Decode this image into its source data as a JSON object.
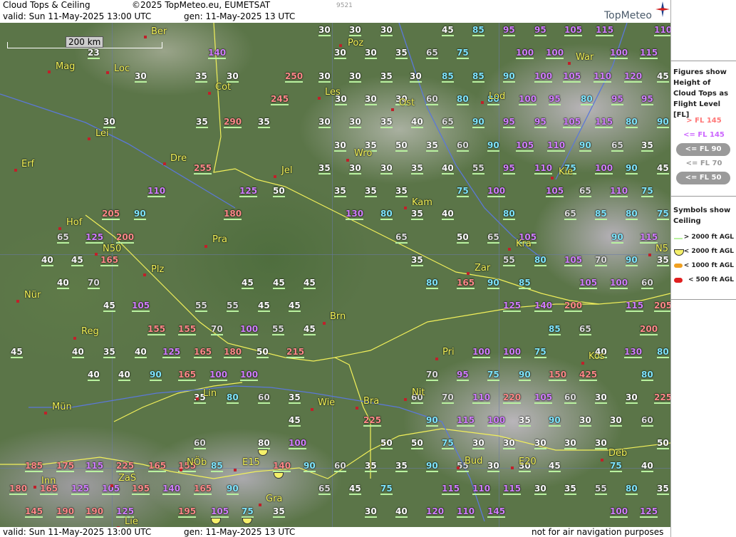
{
  "header": {
    "title": "Cloud Tops & Ceiling",
    "copyright": "©2025 TopMeteo.eu, EUMETSAT",
    "code": "9521",
    "valid": "valid:  Sun  11-May-2025  13:00 UTC",
    "gen": "gen: 11-May-2025 13 UTC",
    "brand": "TopMeteo"
  },
  "footer": {
    "valid": "valid:  Sun  11-May-2025  13:00 UTC",
    "gen": "gen: 11-May-2025 13 UTC",
    "disclaimer": "not for air navigation purposes"
  },
  "scale_label": "200 km",
  "legend": {
    "heading": "Figures show Height of Cloud Tops as Flight Level  [FL]",
    "items": [
      {
        "label": "> FL 145",
        "color": "#ff7777"
      },
      {
        "label": "<= FL 145",
        "color": "#cc66ff"
      },
      {
        "label": "<= FL 90",
        "color": "#55ddff"
      },
      {
        "label": "<= FL 70",
        "color": "#999999"
      },
      {
        "label": "<= FL 50",
        "color": "#ffffff"
      }
    ],
    "symbols_heading": "Symbols show Ceiling",
    "symbols": [
      {
        "label": "> 2000 ft AGL",
        "color": "#b9f2a0"
      },
      {
        "label": "< 2000 ft AGL",
        "color": "#f5f06a"
      },
      {
        "label": "< 1000 ft AGL",
        "color": "#f0a020"
      },
      {
        "label": "< 500 ft AGL",
        "color": "#e02020"
      }
    ]
  },
  "cities": [
    "Ber",
    "Poz",
    "War",
    "Mag",
    "Loc",
    "Cot",
    "Les",
    "Lod",
    "Ost",
    "Erf",
    "Lei",
    "Dre",
    "Jel",
    "Wro",
    "Kie",
    "Kam",
    "Hof",
    "Pra",
    "Kra",
    "N50",
    "Zar",
    "Plz",
    "Nür",
    "Brn",
    "Reg",
    "Pri",
    "Kos",
    "Lin",
    "Nit",
    "Mün",
    "Wie",
    "Bra",
    "Deb",
    "Inn",
    "ZaS",
    "NÖb",
    "E15",
    "Bud",
    "E20",
    "Gra",
    "Lie",
    "N5"
  ],
  "values": [
    {
      "t": "30",
      "c": "white"
    },
    {
      "t": "30",
      "c": "white"
    },
    {
      "t": "30",
      "c": "white"
    },
    {
      "t": "45",
      "c": "white"
    },
    {
      "t": "85",
      "c": "cyan"
    },
    {
      "t": "95",
      "c": "violet"
    },
    {
      "t": "95",
      "c": "violet"
    },
    {
      "t": "105",
      "c": "violet"
    },
    {
      "t": "115",
      "c": "violet"
    },
    {
      "t": "110",
      "c": "violet"
    },
    {
      "t": "23",
      "c": "white"
    },
    {
      "t": "140",
      "c": "violet"
    },
    {
      "t": "30",
      "c": "white"
    },
    {
      "t": "30",
      "c": "white"
    },
    {
      "t": "35",
      "c": "white"
    },
    {
      "t": "65",
      "c": "gray"
    },
    {
      "t": "75",
      "c": "cyan"
    },
    {
      "t": "100",
      "c": "violet"
    },
    {
      "t": "100",
      "c": "violet"
    },
    {
      "t": "100",
      "c": "violet"
    },
    {
      "t": "115",
      "c": "violet"
    },
    {
      "t": "30",
      "c": "white"
    },
    {
      "t": "35",
      "c": "white"
    },
    {
      "t": "30",
      "c": "white"
    },
    {
      "t": "250",
      "c": "pink"
    },
    {
      "t": "30",
      "c": "white"
    },
    {
      "t": "30",
      "c": "white"
    },
    {
      "t": "35",
      "c": "white"
    },
    {
      "t": "30",
      "c": "white"
    },
    {
      "t": "85",
      "c": "cyan"
    },
    {
      "t": "85",
      "c": "cyan"
    },
    {
      "t": "90",
      "c": "cyan"
    },
    {
      "t": "100",
      "c": "violet"
    },
    {
      "t": "105",
      "c": "violet"
    },
    {
      "t": "110",
      "c": "violet"
    },
    {
      "t": "120",
      "c": "violet"
    },
    {
      "t": "45",
      "c": "white"
    },
    {
      "t": "245",
      "c": "pink"
    },
    {
      "t": "30",
      "c": "white"
    },
    {
      "t": "30",
      "c": "white"
    },
    {
      "t": "30",
      "c": "white"
    },
    {
      "t": "60",
      "c": "gray"
    },
    {
      "t": "80",
      "c": "cyan"
    },
    {
      "t": "80",
      "c": "cyan"
    },
    {
      "t": "100",
      "c": "violet"
    },
    {
      "t": "95",
      "c": "violet"
    },
    {
      "t": "80",
      "c": "cyan"
    },
    {
      "t": "95",
      "c": "violet"
    },
    {
      "t": "95",
      "c": "violet"
    },
    {
      "t": "30",
      "c": "white"
    },
    {
      "t": "35",
      "c": "white"
    },
    {
      "t": "290",
      "c": "pink"
    },
    {
      "t": "35",
      "c": "white"
    },
    {
      "t": "30",
      "c": "white"
    },
    {
      "t": "30",
      "c": "white"
    },
    {
      "t": "35",
      "c": "white"
    },
    {
      "t": "40",
      "c": "white"
    },
    {
      "t": "65",
      "c": "gray"
    },
    {
      "t": "90",
      "c": "cyan"
    },
    {
      "t": "95",
      "c": "violet"
    },
    {
      "t": "95",
      "c": "violet"
    },
    {
      "t": "105",
      "c": "violet"
    },
    {
      "t": "115",
      "c": "violet"
    },
    {
      "t": "80",
      "c": "cyan"
    },
    {
      "t": "90",
      "c": "cyan"
    },
    {
      "t": "30",
      "c": "white"
    },
    {
      "t": "35",
      "c": "white"
    },
    {
      "t": "50",
      "c": "white"
    },
    {
      "t": "35",
      "c": "white"
    },
    {
      "t": "60",
      "c": "gray"
    },
    {
      "t": "90",
      "c": "cyan"
    },
    {
      "t": "105",
      "c": "violet"
    },
    {
      "t": "110",
      "c": "violet"
    },
    {
      "t": "90",
      "c": "cyan"
    },
    {
      "t": "65",
      "c": "gray"
    },
    {
      "t": "35",
      "c": "white"
    },
    {
      "t": "255",
      "c": "pink"
    },
    {
      "t": "35",
      "c": "white"
    },
    {
      "t": "30",
      "c": "white"
    },
    {
      "t": "30",
      "c": "white"
    },
    {
      "t": "35",
      "c": "white"
    },
    {
      "t": "40",
      "c": "white"
    },
    {
      "t": "55",
      "c": "gray"
    },
    {
      "t": "95",
      "c": "violet"
    },
    {
      "t": "110",
      "c": "violet"
    },
    {
      "t": "75",
      "c": "cyan"
    },
    {
      "t": "100",
      "c": "violet"
    },
    {
      "t": "90",
      "c": "cyan"
    },
    {
      "t": "45",
      "c": "white"
    },
    {
      "t": "110",
      "c": "violet"
    },
    {
      "t": "125",
      "c": "violet"
    },
    {
      "t": "50",
      "c": "white"
    },
    {
      "t": "35",
      "c": "white"
    },
    {
      "t": "35",
      "c": "white"
    },
    {
      "t": "35",
      "c": "white"
    },
    {
      "t": "75",
      "c": "cyan"
    },
    {
      "t": "100",
      "c": "violet"
    },
    {
      "t": "105",
      "c": "violet"
    },
    {
      "t": "65",
      "c": "gray"
    },
    {
      "t": "110",
      "c": "violet"
    },
    {
      "t": "75",
      "c": "cyan"
    },
    {
      "t": "205",
      "c": "pink"
    },
    {
      "t": "90",
      "c": "cyan"
    },
    {
      "t": "180",
      "c": "pink"
    },
    {
      "t": "130",
      "c": "violet"
    },
    {
      "t": "80",
      "c": "cyan"
    },
    {
      "t": "35",
      "c": "white"
    },
    {
      "t": "40",
      "c": "white"
    },
    {
      "t": "80",
      "c": "cyan"
    },
    {
      "t": "65",
      "c": "gray"
    },
    {
      "t": "85",
      "c": "cyan"
    },
    {
      "t": "80",
      "c": "cyan"
    },
    {
      "t": "75",
      "c": "cyan"
    },
    {
      "t": "65",
      "c": "gray"
    },
    {
      "t": "125",
      "c": "violet"
    },
    {
      "t": "200",
      "c": "pink"
    },
    {
      "t": "65",
      "c": "gray"
    },
    {
      "t": "50",
      "c": "white"
    },
    {
      "t": "65",
      "c": "gray"
    },
    {
      "t": "105",
      "c": "violet"
    },
    {
      "t": "90",
      "c": "cyan"
    },
    {
      "t": "115",
      "c": "violet"
    },
    {
      "t": "40",
      "c": "white"
    },
    {
      "t": "45",
      "c": "white"
    },
    {
      "t": "165",
      "c": "pink"
    },
    {
      "t": "35",
      "c": "white"
    },
    {
      "t": "55",
      "c": "gray"
    },
    {
      "t": "80",
      "c": "cyan"
    },
    {
      "t": "105",
      "c": "violet"
    },
    {
      "t": "70",
      "c": "gray"
    },
    {
      "t": "90",
      "c": "cyan"
    },
    {
      "t": "35",
      "c": "white"
    },
    {
      "t": "40",
      "c": "white"
    },
    {
      "t": "70",
      "c": "gray"
    },
    {
      "t": "45",
      "c": "white"
    },
    {
      "t": "45",
      "c": "white"
    },
    {
      "t": "45",
      "c": "white"
    },
    {
      "t": "80",
      "c": "cyan"
    },
    {
      "t": "165",
      "c": "pink"
    },
    {
      "t": "90",
      "c": "cyan"
    },
    {
      "t": "85",
      "c": "cyan"
    },
    {
      "t": "105",
      "c": "violet"
    },
    {
      "t": "100",
      "c": "violet"
    },
    {
      "t": "60",
      "c": "gray"
    },
    {
      "t": "45",
      "c": "white"
    },
    {
      "t": "105",
      "c": "violet"
    },
    {
      "t": "55",
      "c": "gray"
    },
    {
      "t": "55",
      "c": "gray"
    },
    {
      "t": "45",
      "c": "white"
    },
    {
      "t": "45",
      "c": "white"
    },
    {
      "t": "125",
      "c": "violet"
    },
    {
      "t": "140",
      "c": "violet"
    },
    {
      "t": "200",
      "c": "pink"
    },
    {
      "t": "115",
      "c": "violet"
    },
    {
      "t": "205",
      "c": "pink"
    },
    {
      "t": "155",
      "c": "pink"
    },
    {
      "t": "155",
      "c": "pink"
    },
    {
      "t": "70",
      "c": "gray"
    },
    {
      "t": "100",
      "c": "violet"
    },
    {
      "t": "55",
      "c": "gray"
    },
    {
      "t": "45",
      "c": "white"
    },
    {
      "t": "85",
      "c": "cyan"
    },
    {
      "t": "65",
      "c": "gray"
    },
    {
      "t": "200",
      "c": "pink"
    },
    {
      "t": "45",
      "c": "white"
    },
    {
      "t": "40",
      "c": "white"
    },
    {
      "t": "35",
      "c": "white"
    },
    {
      "t": "40",
      "c": "white"
    },
    {
      "t": "125",
      "c": "violet"
    },
    {
      "t": "165",
      "c": "pink"
    },
    {
      "t": "180",
      "c": "pink"
    },
    {
      "t": "50",
      "c": "white"
    },
    {
      "t": "215",
      "c": "pink"
    },
    {
      "t": "100",
      "c": "violet"
    },
    {
      "t": "100",
      "c": "violet"
    },
    {
      "t": "75",
      "c": "cyan"
    },
    {
      "t": "40",
      "c": "white"
    },
    {
      "t": "130",
      "c": "violet"
    },
    {
      "t": "80",
      "c": "cyan"
    },
    {
      "t": "40",
      "c": "white"
    },
    {
      "t": "40",
      "c": "white"
    },
    {
      "t": "90",
      "c": "cyan"
    },
    {
      "t": "165",
      "c": "pink"
    },
    {
      "t": "100",
      "c": "violet"
    },
    {
      "t": "100",
      "c": "violet"
    },
    {
      "t": "70",
      "c": "gray"
    },
    {
      "t": "95",
      "c": "violet"
    },
    {
      "t": "75",
      "c": "cyan"
    },
    {
      "t": "90",
      "c": "cyan"
    },
    {
      "t": "150",
      "c": "pink"
    },
    {
      "t": "425",
      "c": "pink"
    },
    {
      "t": "80",
      "c": "cyan"
    },
    {
      "t": "35",
      "c": "white"
    },
    {
      "t": "80",
      "c": "cyan"
    },
    {
      "t": "60",
      "c": "gray"
    },
    {
      "t": "35",
      "c": "white"
    },
    {
      "t": "60",
      "c": "gray"
    },
    {
      "t": "70",
      "c": "gray"
    },
    {
      "t": "110",
      "c": "violet"
    },
    {
      "t": "220",
      "c": "pink"
    },
    {
      "t": "105",
      "c": "violet"
    },
    {
      "t": "60",
      "c": "gray"
    },
    {
      "t": "30",
      "c": "white"
    },
    {
      "t": "30",
      "c": "white"
    },
    {
      "t": "225",
      "c": "pink"
    },
    {
      "t": "45",
      "c": "white"
    },
    {
      "t": "225",
      "c": "pink"
    },
    {
      "t": "90",
      "c": "cyan"
    },
    {
      "t": "115",
      "c": "violet"
    },
    {
      "t": "100",
      "c": "violet"
    },
    {
      "t": "35",
      "c": "white"
    },
    {
      "t": "90",
      "c": "cyan"
    },
    {
      "t": "30",
      "c": "white"
    },
    {
      "t": "30",
      "c": "white"
    },
    {
      "t": "60",
      "c": "gray"
    },
    {
      "t": "60",
      "c": "gray"
    },
    {
      "t": "80",
      "c": "white"
    },
    {
      "t": "100",
      "c": "violet"
    },
    {
      "t": "50",
      "c": "white"
    },
    {
      "t": "50",
      "c": "white"
    },
    {
      "t": "75",
      "c": "cyan"
    },
    {
      "t": "30",
      "c": "white"
    },
    {
      "t": "30",
      "c": "white"
    },
    {
      "t": "30",
      "c": "white"
    },
    {
      "t": "30",
      "c": "white"
    },
    {
      "t": "30",
      "c": "white"
    },
    {
      "t": "50",
      "c": "white"
    },
    {
      "t": "185",
      "c": "pink"
    },
    {
      "t": "175",
      "c": "pink"
    },
    {
      "t": "115",
      "c": "violet"
    },
    {
      "t": "225",
      "c": "pink"
    },
    {
      "t": "165",
      "c": "pink"
    },
    {
      "t": "155",
      "c": "pink"
    },
    {
      "t": "85",
      "c": "cyan"
    },
    {
      "t": "140",
      "c": "pink"
    },
    {
      "t": "90",
      "c": "cyan"
    },
    {
      "t": "60",
      "c": "gray"
    },
    {
      "t": "35",
      "c": "white"
    },
    {
      "t": "35",
      "c": "white"
    },
    {
      "t": "90",
      "c": "cyan"
    },
    {
      "t": "55",
      "c": "gray"
    },
    {
      "t": "30",
      "c": "white"
    },
    {
      "t": "30",
      "c": "white"
    },
    {
      "t": "45",
      "c": "white"
    },
    {
      "t": "75",
      "c": "cyan"
    },
    {
      "t": "40",
      "c": "white"
    },
    {
      "t": "180",
      "c": "pink"
    },
    {
      "t": "165",
      "c": "pink"
    },
    {
      "t": "125",
      "c": "violet"
    },
    {
      "t": "105",
      "c": "violet"
    },
    {
      "t": "195",
      "c": "pink"
    },
    {
      "t": "140",
      "c": "violet"
    },
    {
      "t": "165",
      "c": "pink"
    },
    {
      "t": "90",
      "c": "cyan"
    },
    {
      "t": "65",
      "c": "gray"
    },
    {
      "t": "45",
      "c": "white"
    },
    {
      "t": "75",
      "c": "cyan"
    },
    {
      "t": "115",
      "c": "violet"
    },
    {
      "t": "110",
      "c": "violet"
    },
    {
      "t": "115",
      "c": "violet"
    },
    {
      "t": "30",
      "c": "white"
    },
    {
      "t": "35",
      "c": "white"
    },
    {
      "t": "55",
      "c": "gray"
    },
    {
      "t": "80",
      "c": "cyan"
    },
    {
      "t": "35",
      "c": "white"
    },
    {
      "t": "145",
      "c": "pink"
    },
    {
      "t": "190",
      "c": "pink"
    },
    {
      "t": "190",
      "c": "pink"
    },
    {
      "t": "125",
      "c": "violet"
    },
    {
      "t": "195",
      "c": "pink"
    },
    {
      "t": "105",
      "c": "violet"
    },
    {
      "t": "75",
      "c": "cyan"
    },
    {
      "t": "35",
      "c": "white"
    },
    {
      "t": "30",
      "c": "white"
    },
    {
      "t": "40",
      "c": "white"
    },
    {
      "t": "120",
      "c": "violet"
    },
    {
      "t": "110",
      "c": "violet"
    },
    {
      "t": "145",
      "c": "violet"
    },
    {
      "t": "100",
      "c": "violet"
    },
    {
      "t": "125",
      "c": "violet"
    }
  ]
}
